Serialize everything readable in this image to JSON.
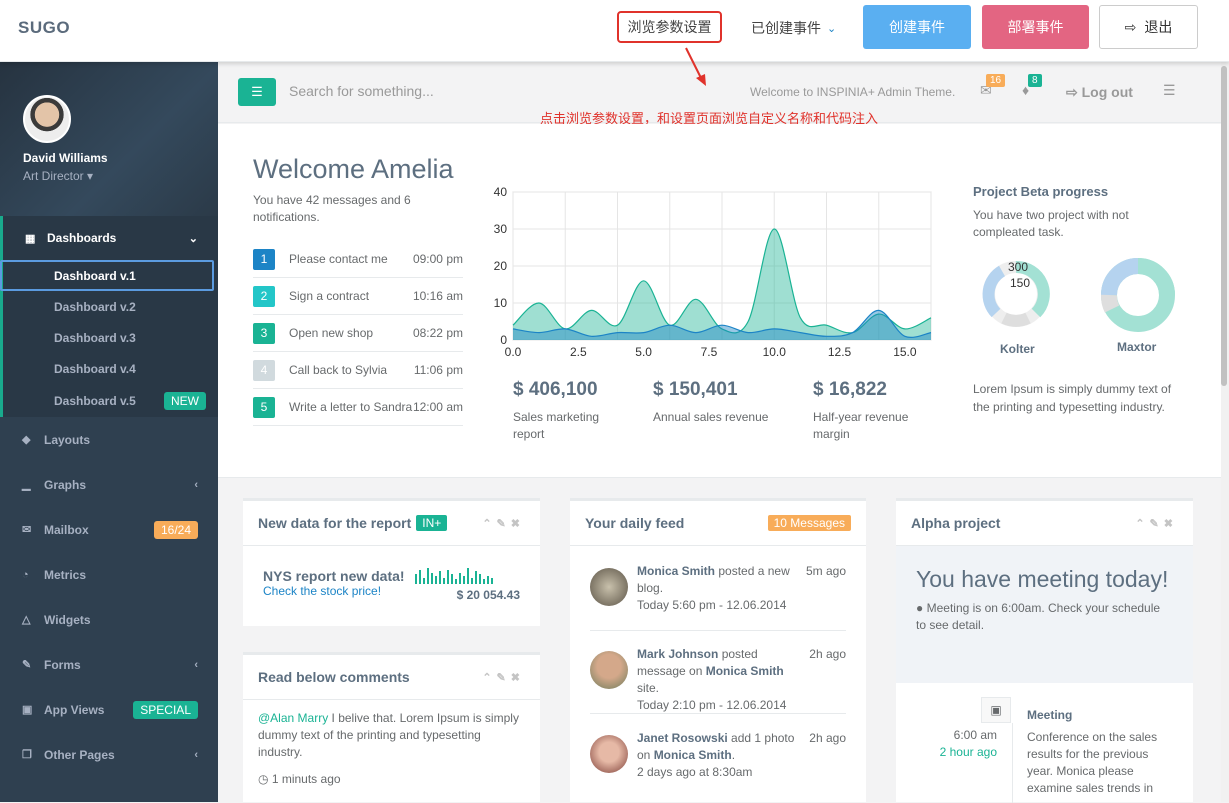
{
  "topbar": {
    "brand": "SUGO",
    "browse_settings": "浏览参数设置",
    "created_events": "已创建事件",
    "create_event": "创建事件",
    "deploy_event": "部署事件",
    "logout": "退出",
    "colors": {
      "create": "#5aaff1",
      "deploy": "#e36582",
      "highlight": "#e0322b"
    }
  },
  "annotation": "点击浏览参数设置，和设置页面浏览自定义名称和代码注入",
  "sidebar": {
    "user_name": "David Williams",
    "user_role": "Art Director",
    "dashboards_label": "Dashboards",
    "sub_items": [
      "Dashboard v.1",
      "Dashboard v.2",
      "Dashboard v.3",
      "Dashboard v.4",
      "Dashboard v.5"
    ],
    "new_badge": "NEW",
    "items": [
      {
        "label": "Layouts",
        "icon": "diamond-icon"
      },
      {
        "label": "Graphs",
        "icon": "bar-chart-icon"
      },
      {
        "label": "Mailbox",
        "icon": "envelope-icon",
        "badge": "16/24"
      },
      {
        "label": "Metrics",
        "icon": "pie-chart-icon"
      },
      {
        "label": "Widgets",
        "icon": "flask-icon"
      },
      {
        "label": "Forms",
        "icon": "edit-icon"
      },
      {
        "label": "App Views",
        "icon": "desktop-icon",
        "badge": "SPECIAL"
      },
      {
        "label": "Other Pages",
        "icon": "files-icon"
      }
    ]
  },
  "header": {
    "search_placeholder": "Search for something...",
    "welcome": "Welcome to INSPINIA+ Admin Theme.",
    "mail_count": "16",
    "bell_count": "8",
    "logout": "Log out"
  },
  "welcome": {
    "title": "Welcome Amelia",
    "subtitle": "You have 42 messages and 6 notifications.",
    "tasks": [
      {
        "n": "1",
        "text": "Please contact me",
        "time": "09:00 pm",
        "color": "#1c84c6"
      },
      {
        "n": "2",
        "text": "Sign a contract",
        "time": "10:16 am",
        "color": "#23c6c8"
      },
      {
        "n": "3",
        "text": "Open new shop",
        "time": "08:22 pm",
        "color": "#1ab394"
      },
      {
        "n": "4",
        "text": "Call back to Sylvia",
        "time": "11:06 pm",
        "color": "#d1dade"
      },
      {
        "n": "5",
        "text": "Write a letter to Sandra",
        "time": "12:00 am",
        "color": "#1ab394"
      }
    ]
  },
  "chart_data": {
    "type": "area",
    "x": [
      0,
      1,
      2,
      3,
      4,
      5,
      6,
      7,
      8,
      9,
      10,
      11,
      12,
      13,
      14,
      15,
      16
    ],
    "xticks": [
      0.0,
      2.5,
      5.0,
      7.5,
      10.0,
      12.5,
      15.0
    ],
    "yticks": [
      0,
      10,
      20,
      30,
      40
    ],
    "ylim": [
      0,
      40
    ],
    "xlim": [
      0,
      16
    ],
    "series": [
      {
        "values": [
          4,
          10,
          3,
          8,
          4,
          16,
          4,
          11,
          3,
          5,
          30,
          6,
          4,
          2,
          7,
          3,
          6
        ],
        "color": "#1ab394"
      },
      {
        "values": [
          3,
          2,
          3,
          1,
          2,
          2,
          4,
          2,
          4,
          2,
          3,
          2,
          1,
          2,
          8,
          1,
          2
        ],
        "color": "#1c84c6"
      }
    ]
  },
  "stats": [
    {
      "value": "$ 406,100",
      "label": "Sales marketing report"
    },
    {
      "value": "$ 150,401",
      "label": "Annual sales revenue"
    },
    {
      "value": "$ 16,822",
      "label": "Half-year revenue margin"
    }
  ],
  "project": {
    "title": "Project Beta progress",
    "desc": "You have two project with not compleated task.",
    "donut1_label": "Kolter",
    "donut2_label": "Maxtor",
    "donut1_values": [
      "300",
      "150"
    ],
    "footer": "Lorem Ipsum is simply dummy text of the printing and typesetting industry."
  },
  "report_box": {
    "title": "New data for the report",
    "label": "IN+",
    "headline": "NYS report new data!",
    "link": "Check the stock price!",
    "amount": "$ 20 054.43",
    "spark": [
      60,
      90,
      40,
      100,
      70,
      50,
      80,
      40,
      90,
      60,
      30,
      70,
      50,
      100,
      40,
      80,
      60,
      30,
      50,
      40
    ]
  },
  "comments_box": {
    "title": "Read below comments",
    "mention": "@Alan Marry",
    "text": " I belive that. Lorem Ipsum is simply dummy text of the printing and typesetting industry.",
    "time": "1 minuts ago"
  },
  "feed_box": {
    "title": "Your daily feed",
    "label": "10 Messages",
    "items": [
      {
        "name": "Monica Smith",
        "text": " posted a new blog.",
        "date": "Today 5:60 pm - 12.06.2014",
        "ago": "5m ago"
      },
      {
        "name": "Mark Johnson",
        "text": " posted message on ",
        "target": "Monica Smith",
        "tail": " site.",
        "date": "Today 2:10 pm - 12.06.2014",
        "ago": "2h ago"
      },
      {
        "name": "Janet Rosowski",
        "text": " add 1 photo on ",
        "target": "Monica Smith",
        "tail": ".",
        "date": "2 days ago at 8:30am",
        "ago": "2h ago"
      }
    ]
  },
  "alpha_box": {
    "title": "Alpha project",
    "headline": "You have meeting today!",
    "info": "Meeting is on 6:00am. Check your schedule to see detail.",
    "time": "6:00 am",
    "ago": "2 hour ago",
    "event_title": "Meeting",
    "event_text": "Conference on the sales results for the previous year. Monica please examine sales trends in"
  }
}
